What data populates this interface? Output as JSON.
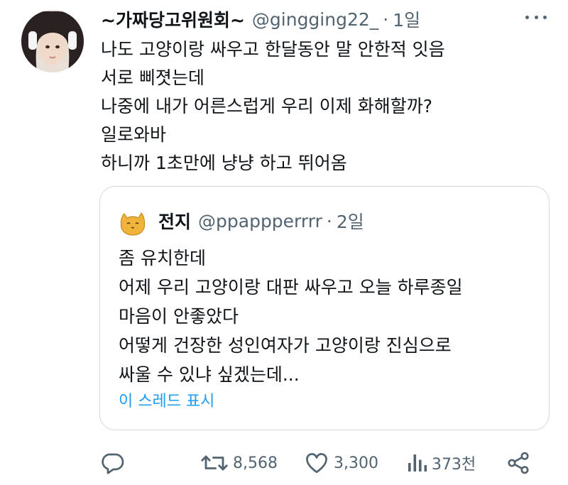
{
  "tweet": {
    "display_name": "~가짜당고위원회~",
    "handle": "@gingging22_",
    "separator": "·",
    "time": "1일",
    "lines": [
      "나도 고양이랑 싸우고 한달동안 말 안한적 잇음",
      "서로 삐졋는데",
      "나중에 내가 어른스럽게 우리 이제 화해할까?",
      "일로와바",
      "하니까 1초만에 냥냥 하고 뛰어옴"
    ]
  },
  "quote": {
    "display_name": "전지",
    "handle": "@ppappperrrr",
    "separator": "·",
    "time": "2일",
    "lines": [
      "좀 유치한데",
      "어제 우리 고양이랑 대판 싸우고 오늘 하루종일",
      "마음이 안좋았다",
      "어떻게 건장한 성인여자가 고양이랑 진심으로",
      "싸울 수 있냐 싶겠는데..."
    ],
    "show_thread": "이 스레드 표시"
  },
  "actions": {
    "retweets": "8,568",
    "likes": "3,300",
    "views": "373천"
  },
  "colors": {
    "accent": "#1d9bf0",
    "secondary_text": "#536471",
    "border": "#cfd9de"
  },
  "icons": [
    "more-icon",
    "reply-icon",
    "retweet-icon",
    "like-icon",
    "views-icon",
    "share-icon"
  ]
}
